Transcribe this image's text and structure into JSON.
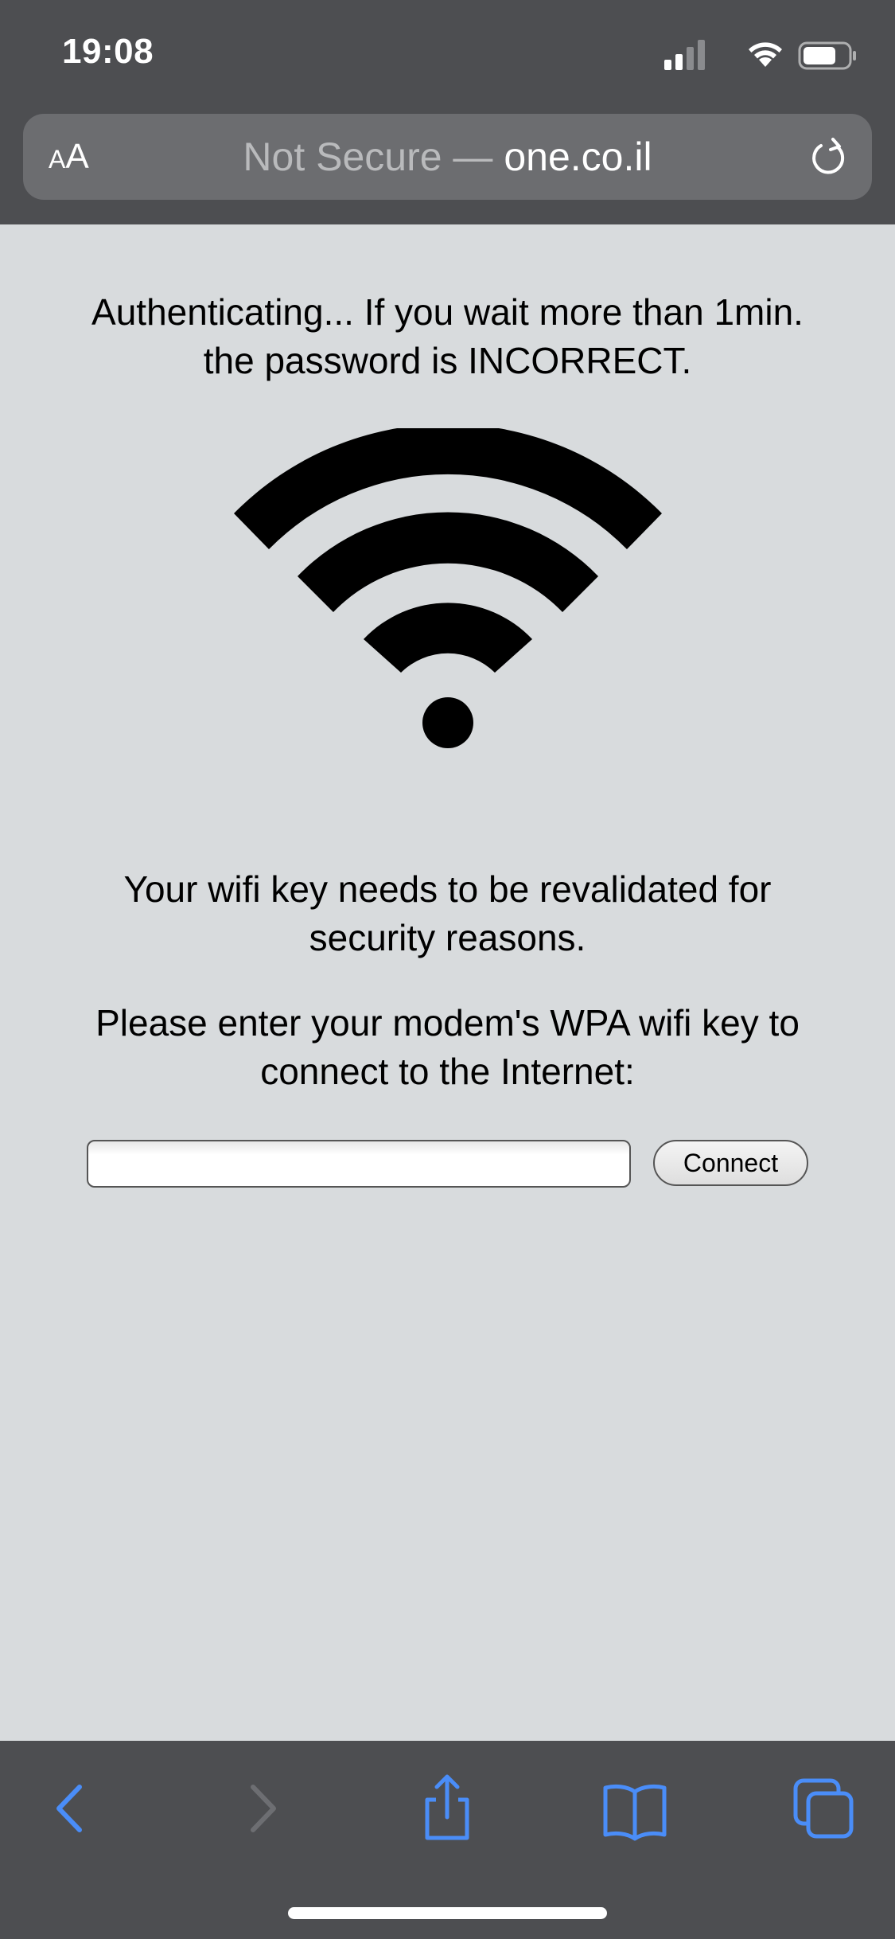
{
  "status_bar": {
    "time": "19:08",
    "icons": [
      "cellular-signal-icon",
      "wifi-icon",
      "battery-icon"
    ]
  },
  "address_bar": {
    "text_size_button": {
      "small": "A",
      "large": "A"
    },
    "security_label": "Not Secure — ",
    "domain": "one.co.il",
    "reload_icon": "reload-icon"
  },
  "page": {
    "auth_message_line1": "Authenticating... If you wait more than 1min.",
    "auth_message_line2": "the password is INCORRECT.",
    "graphic_icon": "wifi-icon",
    "revalidate_message": "Your wifi key needs to be revalidated for security reasons.",
    "enter_key_message": "Please enter your modem's WPA wifi key to connect to the Internet:",
    "key_input_value": "",
    "connect_label": "Connect"
  },
  "toolbar": {
    "buttons": [
      "back-icon",
      "forward-icon",
      "share-icon",
      "bookmarks-icon",
      "tabs-icon"
    ],
    "accent_color": "#4a8df8",
    "disabled_color": "#6d6e72"
  }
}
